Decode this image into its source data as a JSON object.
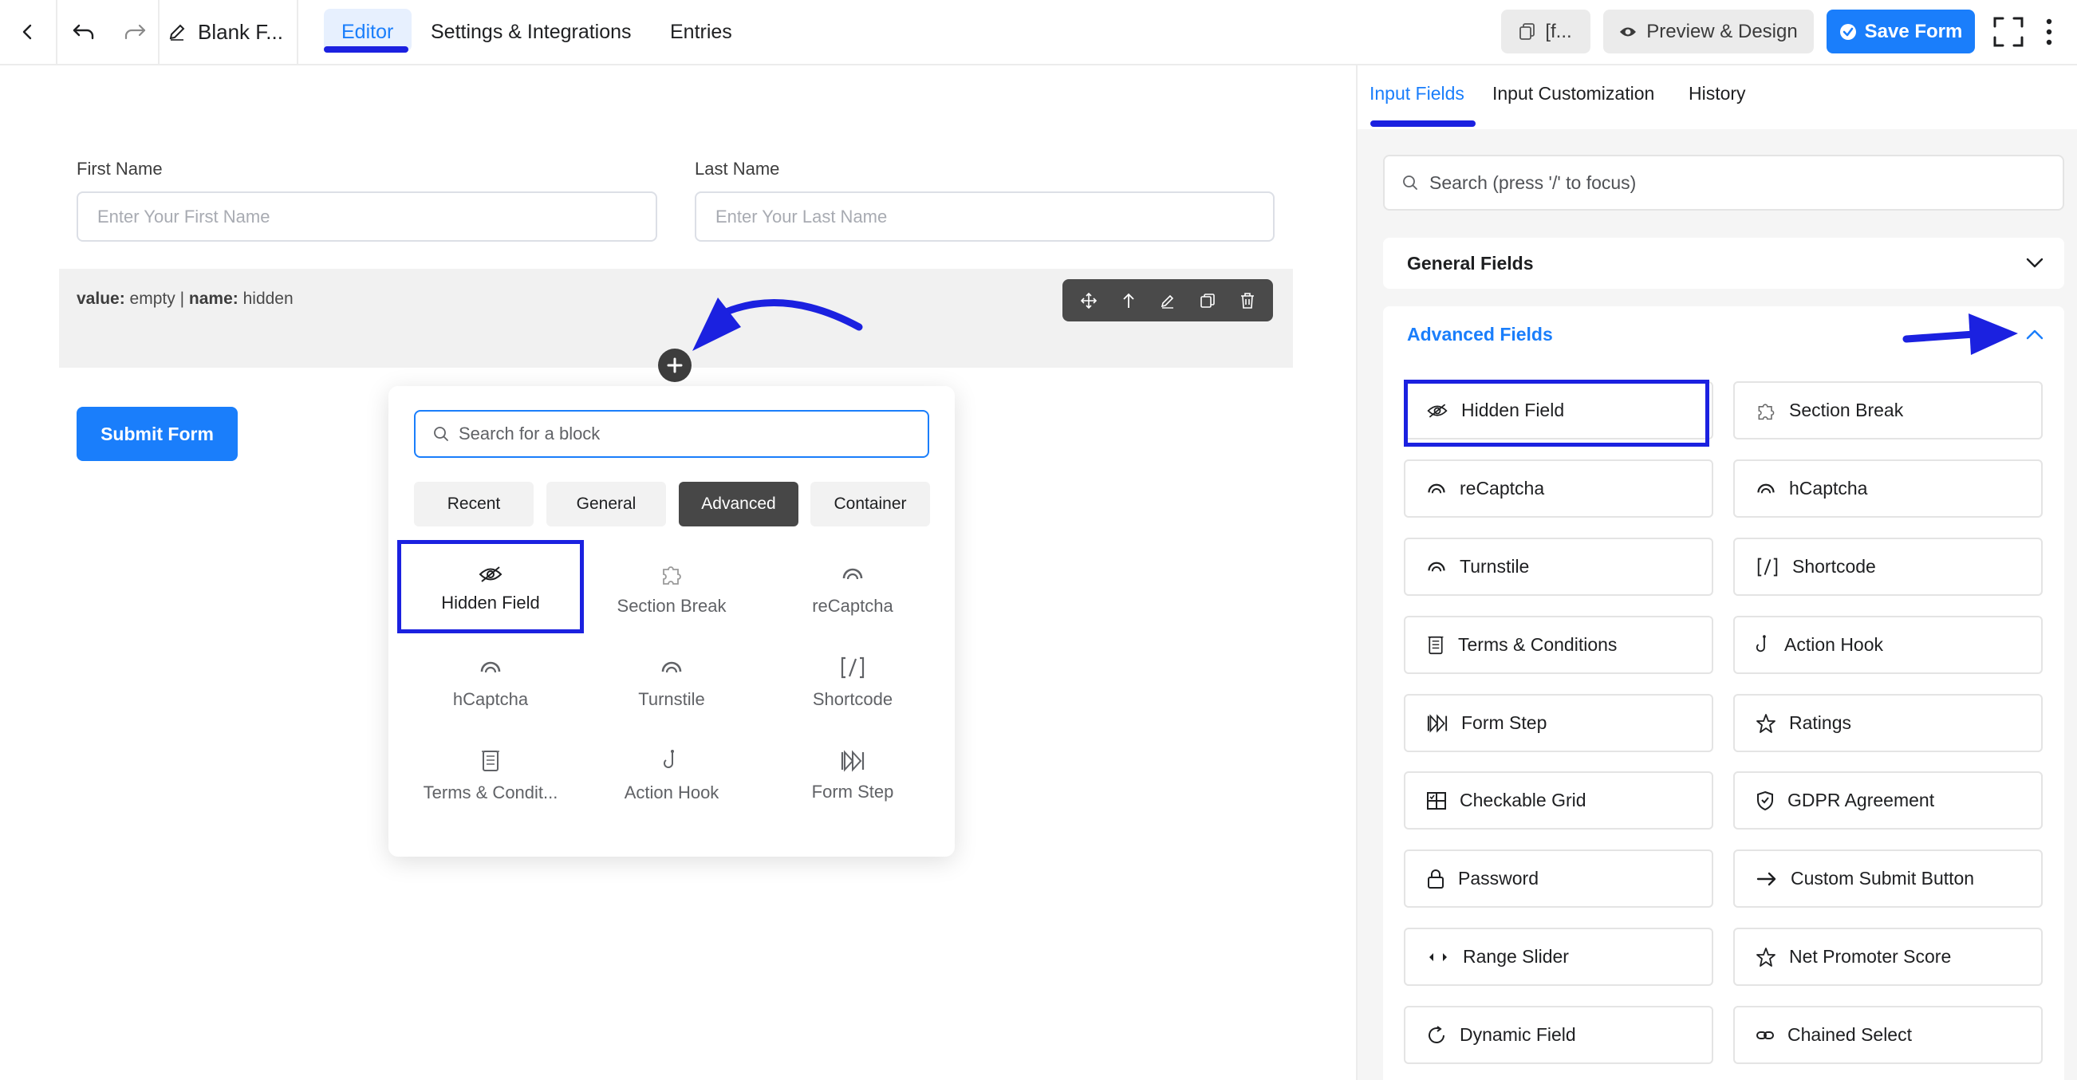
{
  "topbar": {
    "form_title": "Blank F...",
    "tabs": [
      {
        "label": "Editor",
        "active": true
      },
      {
        "label": "Settings & Integrations",
        "active": false
      },
      {
        "label": "Entries",
        "active": false
      }
    ],
    "shortcode_label": "[f...",
    "preview_label": "Preview & Design",
    "save_label": "Save Form"
  },
  "canvas": {
    "first_name": {
      "label": "First Name",
      "placeholder": "Enter Your First Name"
    },
    "last_name": {
      "label": "Last Name",
      "placeholder": "Enter Your Last Name"
    },
    "hidden_block": {
      "value_key": "value:",
      "value_val": "empty",
      "sep": "|",
      "name_key": "name:",
      "name_val": "hidden"
    },
    "submit_label": "Submit Form"
  },
  "popup": {
    "search_placeholder": "Search for a block",
    "tabs": [
      "Recent",
      "General",
      "Advanced",
      "Container"
    ],
    "active_tab": "Advanced",
    "items": [
      {
        "label": "Hidden Field",
        "icon": "eye-slash-icon"
      },
      {
        "label": "Section Break",
        "icon": "puzzle-icon"
      },
      {
        "label": "reCaptcha",
        "icon": "captcha-icon"
      },
      {
        "label": "hCaptcha",
        "icon": "captcha-icon"
      },
      {
        "label": "Turnstile",
        "icon": "captcha-icon"
      },
      {
        "label": "Shortcode",
        "icon": "shortcode-icon"
      },
      {
        "label": "Terms & Condit...",
        "icon": "document-icon"
      },
      {
        "label": "Action Hook",
        "icon": "hook-icon"
      },
      {
        "label": "Form Step",
        "icon": "step-icon"
      }
    ]
  },
  "panel": {
    "tabs": [
      {
        "label": "Input Fields",
        "active": true
      },
      {
        "label": "Input Customization",
        "active": false
      },
      {
        "label": "History",
        "active": false
      }
    ],
    "search_placeholder": "Search (press '/' to focus)",
    "general_fields_label": "General Fields",
    "advanced_fields_label": "Advanced Fields",
    "items": [
      {
        "label": "Hidden Field",
        "icon": "eye-slash-icon"
      },
      {
        "label": "Section Break",
        "icon": "puzzle-icon"
      },
      {
        "label": "reCaptcha",
        "icon": "captcha-icon"
      },
      {
        "label": "hCaptcha",
        "icon": "captcha-icon"
      },
      {
        "label": "Turnstile",
        "icon": "captcha-icon"
      },
      {
        "label": "Shortcode",
        "icon": "shortcode-icon"
      },
      {
        "label": "Terms & Conditions",
        "icon": "document-icon"
      },
      {
        "label": "Action Hook",
        "icon": "hook-icon"
      },
      {
        "label": "Form Step",
        "icon": "step-icon"
      },
      {
        "label": "Ratings",
        "icon": "star-icon"
      },
      {
        "label": "Checkable Grid",
        "icon": "grid-icon"
      },
      {
        "label": "GDPR Agreement",
        "icon": "shield-icon"
      },
      {
        "label": "Password",
        "icon": "lock-icon"
      },
      {
        "label": "Custom Submit Button",
        "icon": "arrow-right-icon"
      },
      {
        "label": "Range Slider",
        "icon": "slider-icon"
      },
      {
        "label": "Net Promoter Score",
        "icon": "star-icon"
      },
      {
        "label": "Dynamic Field",
        "icon": "refresh-icon"
      },
      {
        "label": "Chained Select",
        "icon": "link-icon"
      }
    ]
  },
  "colors": {
    "accent": "#1a7efb",
    "annotation": "#1b21e0",
    "toolbar": "#4a4a4a"
  }
}
